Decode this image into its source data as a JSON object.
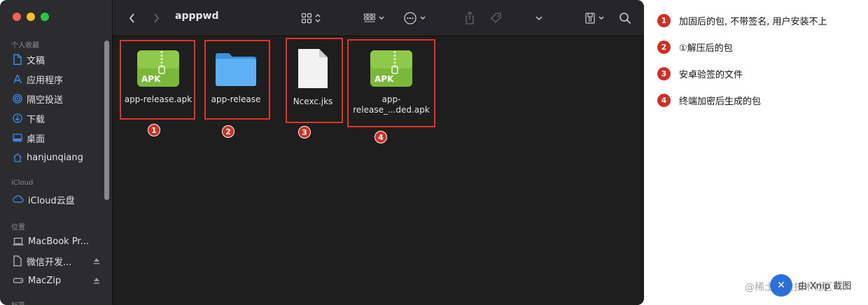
{
  "window": {
    "title": "apppwd"
  },
  "sidebar": {
    "favorites_label": "个人收藏",
    "favorites": [
      {
        "label": "文稿",
        "icon": "document-icon"
      },
      {
        "label": "应用程序",
        "icon": "applications-icon"
      },
      {
        "label": "隔空投送",
        "icon": "airdrop-icon"
      },
      {
        "label": "下载",
        "icon": "download-icon"
      },
      {
        "label": "桌面",
        "icon": "desktop-icon"
      },
      {
        "label": "hanjunqiang",
        "icon": "home-icon"
      }
    ],
    "icloud_label": "iCloud",
    "icloud": [
      {
        "label": "iCloud云盘",
        "icon": "cloud-icon"
      }
    ],
    "locations_label": "位置",
    "locations": [
      {
        "label": "MacBook Pr...",
        "icon": "laptop-icon"
      },
      {
        "label": "微信开发...",
        "icon": "file-icon",
        "ejectable": true
      },
      {
        "label": "MacZip",
        "icon": "disk-icon",
        "ejectable": true
      }
    ],
    "tags_label": "标签"
  },
  "files": [
    {
      "name": "app-release.apk",
      "type": "apk",
      "badge": "APK",
      "number": "1"
    },
    {
      "name": "app-release",
      "type": "folder",
      "number": "2"
    },
    {
      "name": "Ncexc.jks",
      "type": "document",
      "number": "3"
    },
    {
      "name": "app-\nrelease_...ded.apk",
      "name_line1": "app-",
      "name_line2": "release_...ded.apk",
      "type": "apk",
      "badge": "APK",
      "number": "4"
    }
  ],
  "legend": [
    {
      "number": "1",
      "text": "加固后的包, 不带签名, 用户安装不上"
    },
    {
      "number": "2",
      "text": "①解压后的包"
    },
    {
      "number": "3",
      "text": "安卓验签的文件"
    },
    {
      "number": "4",
      "text": "终端加密后生成的包"
    }
  ],
  "watermark": {
    "text": "@稀土掘金技术社区",
    "overlay": "由 Xnip 截图"
  },
  "colors": {
    "highlight": "#e3342a",
    "badge": "#cf2f24",
    "folder": "#47a3f0",
    "apk_green": "#7ab83b"
  }
}
